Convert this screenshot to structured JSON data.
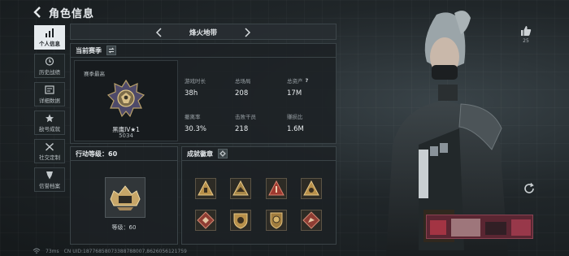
{
  "header": {
    "title": "角色信息"
  },
  "sidebar": {
    "items": [
      {
        "label": "个人信息",
        "icon": "bar-chart-icon",
        "active": true
      },
      {
        "label": "历史战绩",
        "icon": "history-icon",
        "active": false
      },
      {
        "label": "详细数据",
        "icon": "data-icon",
        "active": false
      },
      {
        "label": "敌号成就",
        "icon": "achievement-icon",
        "active": false
      },
      {
        "label": "社交定制",
        "icon": "tools-icon",
        "active": false
      },
      {
        "label": "信誉档案",
        "icon": "shield-icon",
        "active": false
      }
    ]
  },
  "map_selector": {
    "current": "烽火地带"
  },
  "season": {
    "title": "当前赛季",
    "rank_caption": "赛季最高",
    "rank_name": "黑鹰IV★1",
    "rank_score": "5034",
    "stats": [
      {
        "label": "游戏时长",
        "value": "38h"
      },
      {
        "label": "总场局",
        "value": "208"
      },
      {
        "label": "总资产",
        "value": "17M",
        "help": "?"
      },
      {
        "label": "撤离率",
        "value": "30.3%"
      },
      {
        "label": "击败干员",
        "value": "218"
      },
      {
        "label": "赚损比",
        "value": "1.6M"
      }
    ]
  },
  "action_level": {
    "title": "行动等级：60",
    "level_text": "等级：60"
  },
  "achievements": {
    "title": "成就徽章",
    "badges": [
      "badge-1",
      "badge-2",
      "badge-3",
      "badge-4",
      "badge-5",
      "badge-6",
      "badge-7",
      "badge-8"
    ]
  },
  "social": {
    "like_count": "25"
  },
  "footer": {
    "latency": "73ms",
    "uid_text": "CN UID:18776858073388788007,8626056121759"
  },
  "colors": {
    "accent": "#e6ebee",
    "panel": "#1c2124",
    "badge_gold": "#c9a24a",
    "badge_red": "#b8483a"
  }
}
